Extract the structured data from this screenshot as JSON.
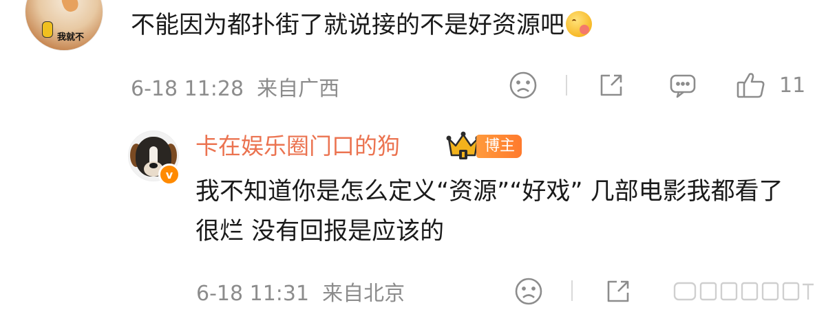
{
  "comment": {
    "avatar_caption": "我就不",
    "text": "不能因为都扑街了就说接的不是好资源吧",
    "emoji": "heart-eyes-emoji",
    "timestamp": "6-18 11:28",
    "location": "来自广西",
    "like_count": "11"
  },
  "reply": {
    "author": "卡在娱乐圈门口的狗",
    "badge_label": "博主",
    "verified_mark": "v",
    "text": "我不知道你是怎么定义“资源”“好戏” 几部电影我都看了 很烂 没有回报是应该的",
    "timestamp": "6-18 11:31",
    "location": "来自北京"
  },
  "colors": {
    "name_orange": "#eb7350",
    "meta_gray": "#8c8c8c",
    "badge_orange": "#ff8a3a"
  }
}
